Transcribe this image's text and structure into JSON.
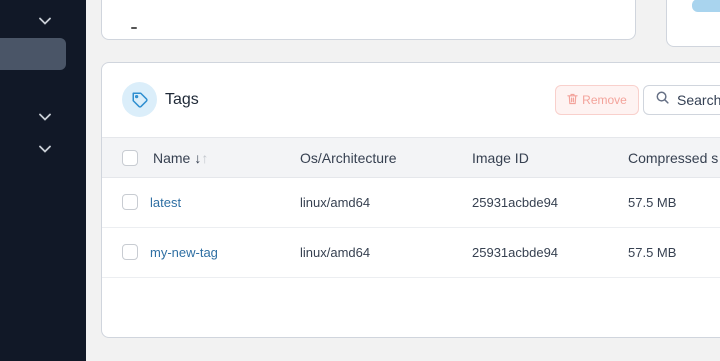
{
  "sidebar": {
    "icons": [
      "chevron-down-icon",
      "chevron-down-icon",
      "chevron-down-icon"
    ]
  },
  "tags_panel": {
    "title": "Tags",
    "icon": "tag-icon",
    "remove_label": "Remove",
    "search_placeholder": "Search",
    "columns": {
      "name": "Name",
      "sort_indicator": "↓",
      "sort_indicator_dim": "↑",
      "os_arch": "Os/Architecture",
      "image_id": "Image ID",
      "compressed_size": "Compressed s"
    },
    "rows": [
      {
        "name": "latest",
        "os_arch": "linux/amd64",
        "image_id": "25931acbde94",
        "compressed_size": "57.5 MB"
      },
      {
        "name": "my-new-tag",
        "os_arch": "linux/amd64",
        "image_id": "25931acbde94",
        "compressed_size": "57.5 MB"
      }
    ]
  },
  "colors": {
    "sidebar_bg": "#111827",
    "link": "#2f6fa3",
    "remove_text": "#f3a39b",
    "accent": "#a9d4ee"
  }
}
